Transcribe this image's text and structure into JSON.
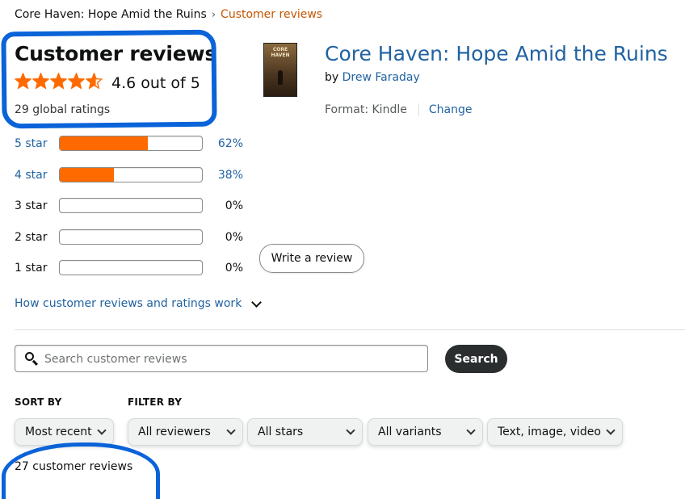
{
  "breadcrumb": {
    "parent": "Core Haven: Hope Amid the Ruins",
    "separator": "›",
    "current": "Customer reviews"
  },
  "summary": {
    "title": "Customer reviews",
    "rating_text": "4.6 out of 5",
    "rating_value": 4.6,
    "star_color": "#ff6a00",
    "global_ratings": "29 global ratings"
  },
  "product": {
    "title": "Core Haven: Hope Amid the Ruins",
    "by_label": "by",
    "author": "Drew Faraday",
    "cover_text": "CORE HAVEN",
    "format_text": "Format: Kindle",
    "change_label": "Change"
  },
  "histogram": [
    {
      "label": "5 star",
      "percent_text": "62%",
      "percent": 62,
      "link": true
    },
    {
      "label": "4 star",
      "percent_text": "38%",
      "percent": 38,
      "link": true
    },
    {
      "label": "3 star",
      "percent_text": "0%",
      "percent": 0,
      "link": false
    },
    {
      "label": "2 star",
      "percent_text": "0%",
      "percent": 0,
      "link": false
    },
    {
      "label": "1 star",
      "percent_text": "0%",
      "percent": 0,
      "link": false
    }
  ],
  "write_review_label": "Write a review",
  "how_link_label": "How customer reviews and ratings work",
  "search": {
    "placeholder": "Search customer reviews",
    "value": "",
    "button_label": "Search"
  },
  "sort": {
    "label": "SORT BY",
    "selected": "Most recent"
  },
  "filter": {
    "label": "FILTER BY",
    "reviewers": "All reviewers",
    "stars": "All stars",
    "variants": "All variants",
    "media": "Text, image, video"
  },
  "review_count": "27 customer reviews",
  "colors": {
    "link": "#2162a1",
    "accent_orange": "#ff6a00",
    "breadcrumb_current": "#c45500",
    "annotation_blue": "#0a63d8"
  }
}
